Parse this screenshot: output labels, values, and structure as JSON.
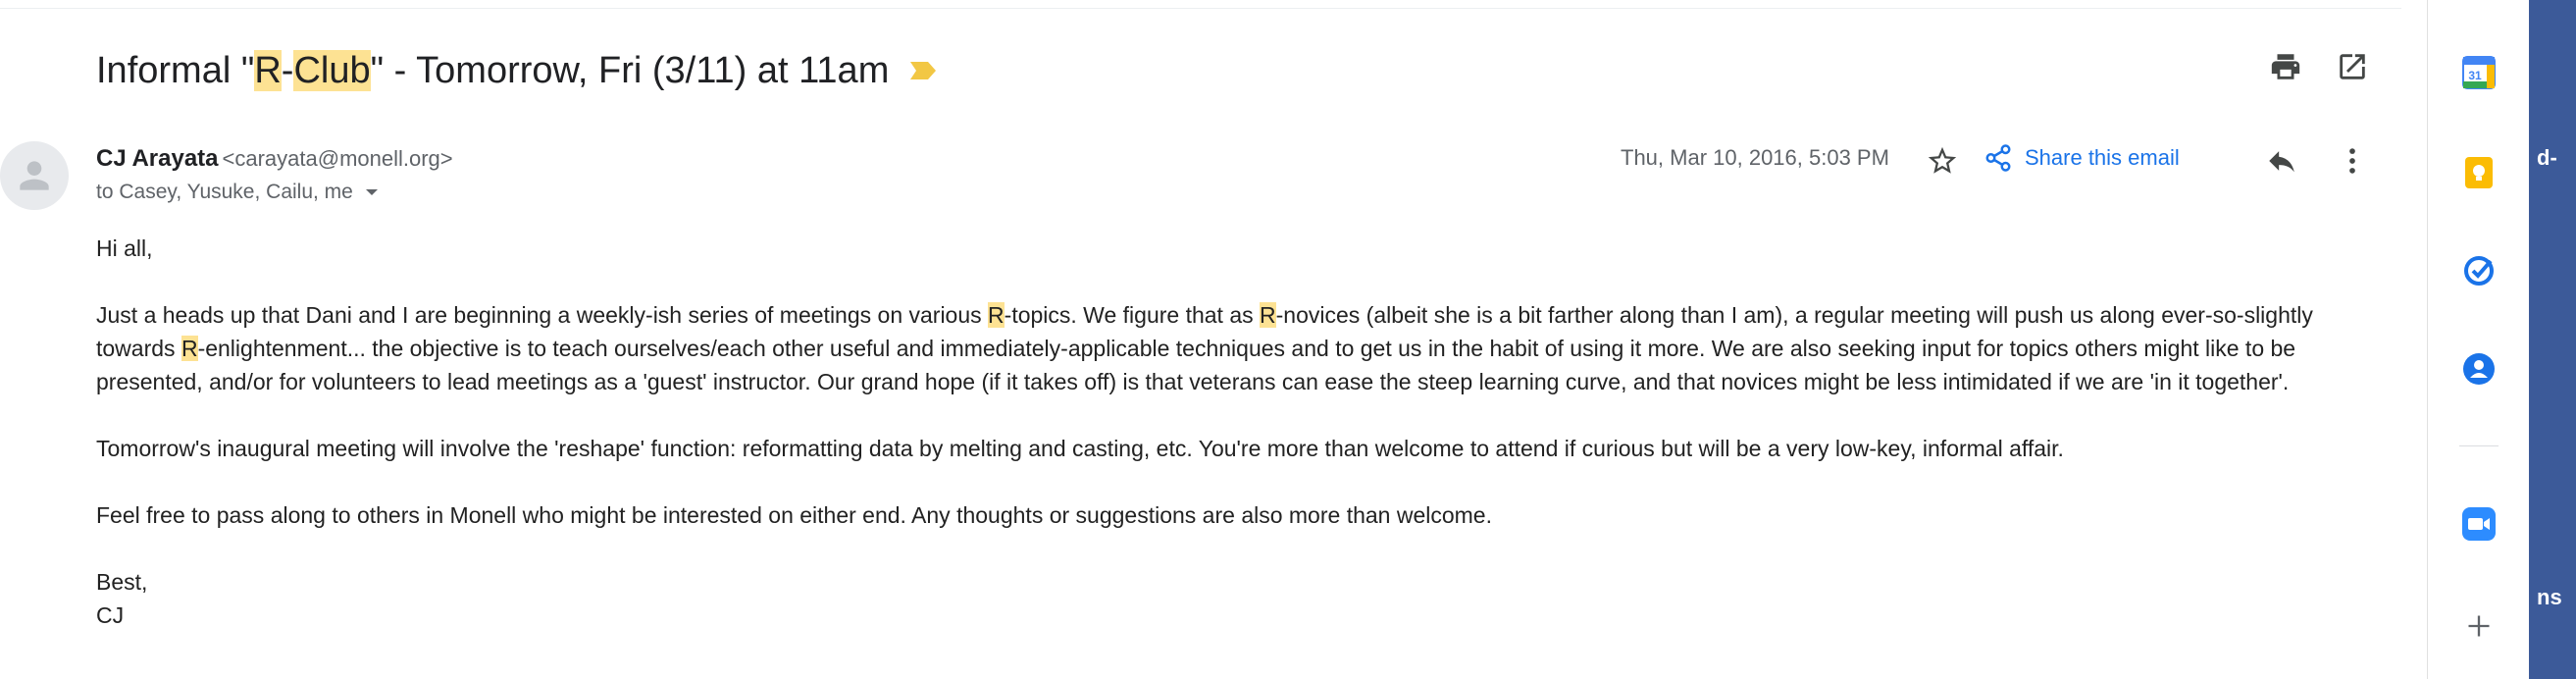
{
  "subject": {
    "pre": "Informal \"",
    "hl1": "R",
    "dash": "-",
    "hl2": "Club",
    "post": "\" - Tomorrow, Fri (3/11) at 11am"
  },
  "sender": {
    "name": "CJ Arayata",
    "email": "<carayata@monell.org>",
    "to": "to Casey, Yusuke, Cailu, me"
  },
  "meta": {
    "date": "Thu, Mar 10, 2016, 5:03 PM",
    "share_label": "Share this email"
  },
  "body": {
    "greeting": "Hi all,",
    "p1": [
      "Just a heads up that Dani and I are beginning a weekly-ish series of meetings on various ",
      "R",
      "-topics. We figure that as ",
      "R",
      "-novices (albeit she is a bit farther along than I am), a regular meeting will push us along ever-so-slightly towards ",
      "R",
      "-enlightenment... the objective is to teach ourselves/each other useful and immediately-applicable techniques and to get us in the habit of using it more. We are also seeking input for topics others might like to be presented, and/or for volunteers to lead meetings as a 'guest' instructor. Our grand hope (if it takes off) is that veterans can ease the steep learning curve, and that novices might be less intimidated if we are 'in it together'."
    ],
    "p2": "Tomorrow's inaugural meeting will involve the 'reshape' function: reformatting data by melting and casting, etc. You're more than welcome to attend if curious but will be a very low-key, informal affair.",
    "p3": "Feel free to pass along to others in Monell who might be interested on either end. Any thoughts or suggestions are also more than welcome.",
    "closing": "Best,",
    "signature": "CJ"
  },
  "sidepanel": {
    "calendar_day": "31"
  },
  "edge": {
    "text_top": "d-",
    "text_bottom": "ns"
  },
  "colors": {
    "highlight": "#fde293",
    "link_blue": "#1a73e8",
    "label_tag": "#f2c744"
  }
}
